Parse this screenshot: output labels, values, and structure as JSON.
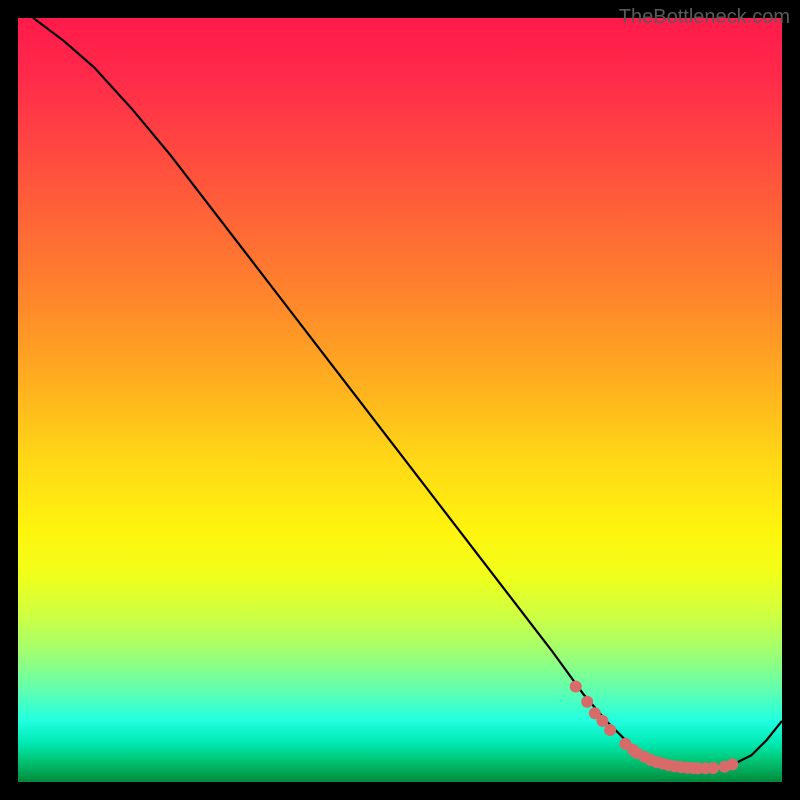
{
  "watermark": "TheBottleneck.com",
  "chart_data": {
    "type": "line",
    "title": "",
    "xlabel": "",
    "ylabel": "",
    "xlim": [
      0,
      100
    ],
    "ylim": [
      0,
      100
    ],
    "series": [
      {
        "name": "curve",
        "x": [
          2,
          6,
          10,
          15,
          20,
          25,
          30,
          35,
          40,
          45,
          50,
          55,
          60,
          65,
          70,
          74,
          77,
          80,
          82,
          84,
          86,
          88,
          90,
          92,
          94,
          96,
          98,
          100
        ],
        "y": [
          100,
          97,
          93.5,
          88,
          82,
          75.5,
          69,
          62.5,
          56,
          49.5,
          43,
          36.5,
          30,
          23.5,
          17,
          11.5,
          8,
          5,
          3.5,
          2.5,
          2,
          1.8,
          1.8,
          2,
          2.5,
          3.5,
          5.5,
          8
        ]
      }
    ],
    "markers": {
      "name": "highlight-dots",
      "color": "#d86a6a",
      "x": [
        73,
        74.5,
        75.5,
        76.5,
        77.5,
        79.5,
        80.5,
        81,
        82,
        82.8,
        83.6,
        84.4,
        85.2,
        86,
        86.8,
        87.6,
        88.4,
        89,
        90,
        91,
        92.5,
        93.5
      ],
      "y": [
        12.5,
        10.5,
        9,
        8,
        6.8,
        5,
        4.2,
        3.8,
        3.3,
        2.9,
        2.6,
        2.4,
        2.2,
        2.05,
        1.95,
        1.88,
        1.83,
        1.8,
        1.8,
        1.83,
        2.0,
        2.3
      ]
    },
    "background": "rainbow-vertical-gradient"
  }
}
